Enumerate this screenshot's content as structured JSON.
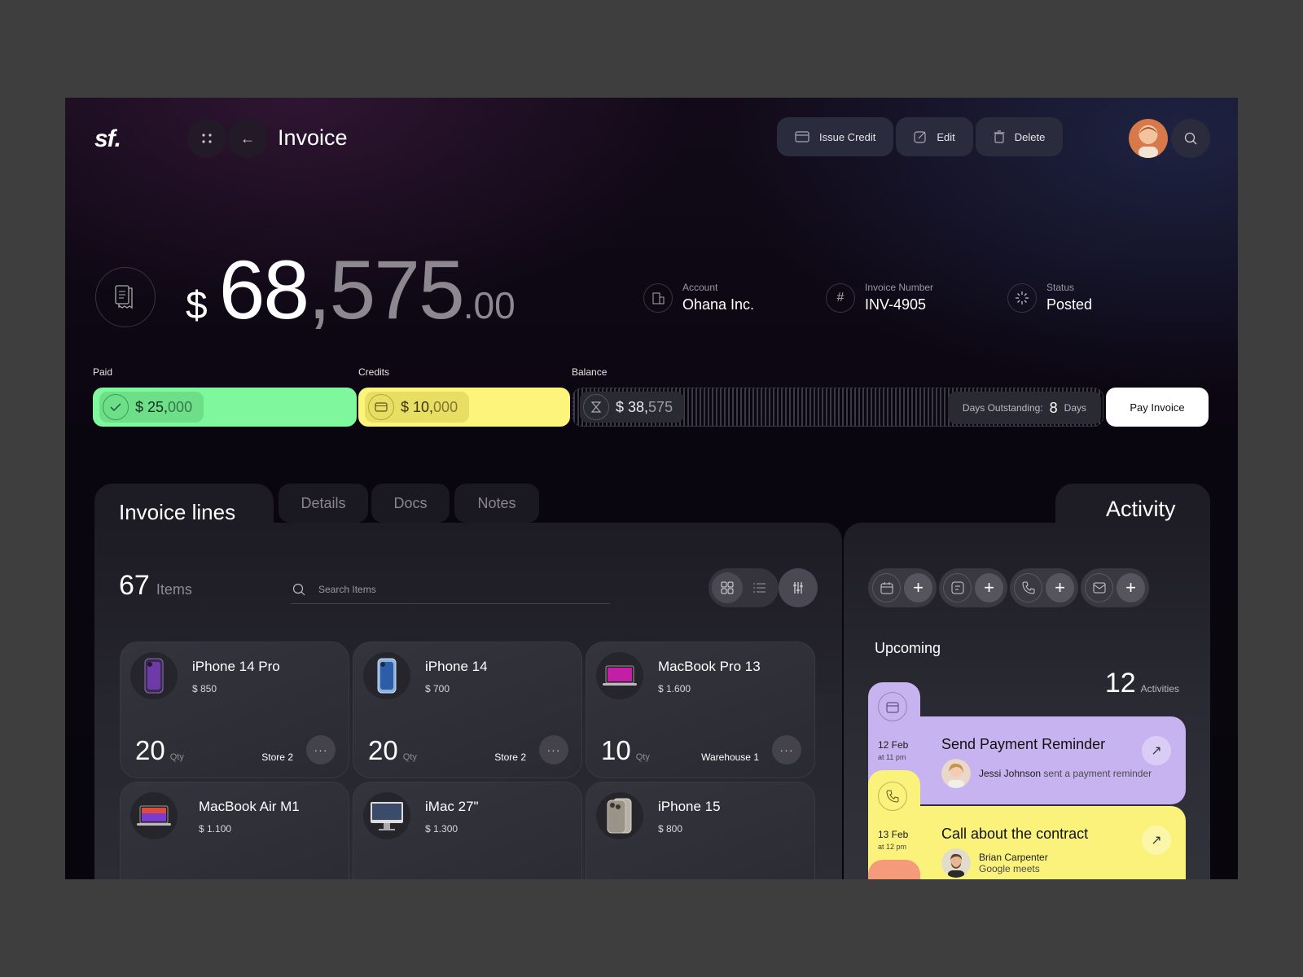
{
  "header": {
    "logo": "sf.",
    "title": "Invoice",
    "actions": {
      "issue_credit": "Issue Credit",
      "edit": "Edit",
      "delete": "Delete"
    }
  },
  "amount": {
    "currency": "$",
    "whole": "68",
    "sep": ",",
    "thousands": "575",
    "decimal": ".00"
  },
  "meta": {
    "account_label": "Account",
    "account_value": "Ohana Inc.",
    "invoice_label": "Invoice Number",
    "invoice_value": "INV-4905",
    "status_label": "Status",
    "status_value": "Posted"
  },
  "payment": {
    "paid_label": "Paid",
    "paid_prefix": "$ 25,",
    "paid_suffix": "000",
    "credits_label": "Credits",
    "credits_prefix": "$ 10,",
    "credits_suffix": "000",
    "balance_label": "Balance",
    "balance_prefix": "$ 38,",
    "balance_suffix": "575",
    "days_label": "Days Outstanding:",
    "days_value": "8",
    "days_unit": "Days",
    "pay_button": "Pay Invoice",
    "colors": {
      "paid": "#7ef79d",
      "credits": "#fdf47c"
    }
  },
  "lines": {
    "title": "Invoice lines",
    "tabs": [
      "Details",
      "Docs",
      "Notes"
    ],
    "count": "67",
    "count_unit": "Items",
    "search_placeholder": "Search Items",
    "items": [
      {
        "name": "iPhone 14 Pro",
        "price": "$ 850",
        "qty": "20",
        "qty_label": "Qty",
        "location": "Store 2",
        "icon": "phone-purple-icon"
      },
      {
        "name": "iPhone 14",
        "price": "$ 700",
        "qty": "20",
        "qty_label": "Qty",
        "location": "Store 2",
        "icon": "phone-blue-icon"
      },
      {
        "name": "MacBook Pro 13",
        "price": "$ 1.600",
        "qty": "10",
        "qty_label": "Qty",
        "location": "Warehouse 1",
        "icon": "laptop-icon"
      },
      {
        "name": "MacBook Air M1",
        "price": "$ 1.100",
        "icon": "laptop-icon"
      },
      {
        "name": "iMac 27\"",
        "price": "$ 1.300",
        "icon": "desktop-icon"
      },
      {
        "name": "iPhone 15",
        "price": "$ 800",
        "icon": "phone-titanium-icon"
      }
    ]
  },
  "activity": {
    "title": "Activity",
    "upcoming": "Upcoming",
    "count": "12",
    "count_unit": "Activities",
    "events": [
      {
        "date": "12 Feb",
        "time": "at 11 pm",
        "title": "Send Payment Reminder",
        "person": "Jessi Johnson",
        "detail": "sent a payment reminder",
        "color": "#c7b3f0"
      },
      {
        "date": "13 Feb",
        "time": "at 12 pm",
        "title": "Call about the contract",
        "person": "Brian Carpenter",
        "detail": "Google meets",
        "color": "#fbf27c"
      }
    ]
  }
}
